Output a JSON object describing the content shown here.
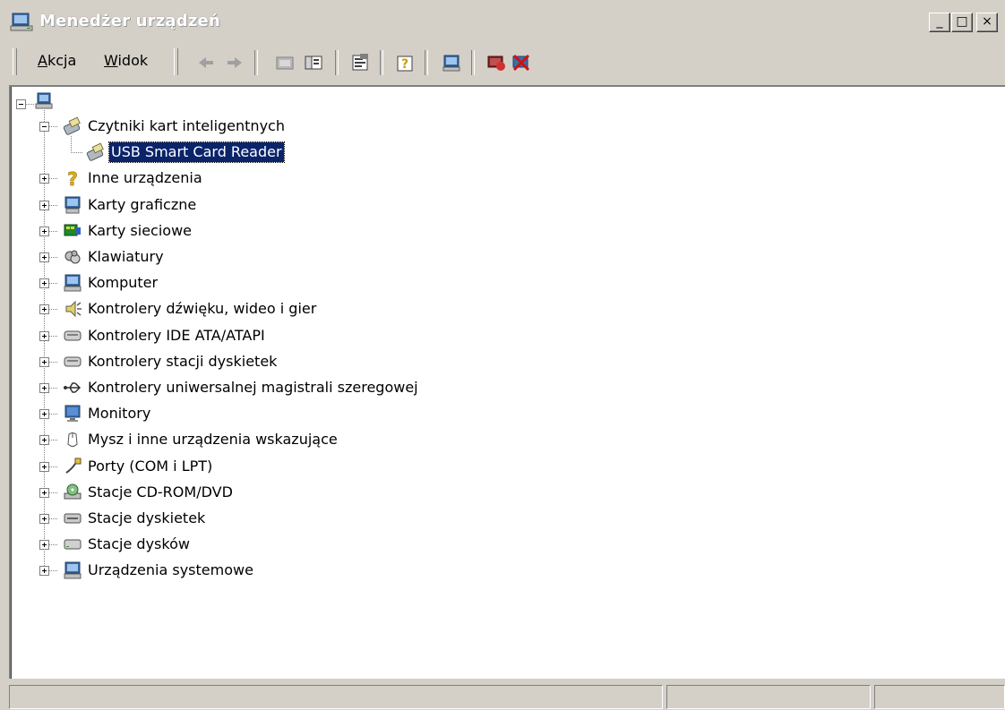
{
  "window": {
    "title": "Menedżer urządzeń",
    "controls": {
      "minimize": "_",
      "maximize": "□",
      "close": "×"
    }
  },
  "menubar": {
    "items": [
      {
        "label_prefix": "",
        "label_u": "A",
        "label_rest": "kcja"
      },
      {
        "label_prefix": "",
        "label_u": "W",
        "label_rest": "idok"
      }
    ]
  },
  "toolbar": {
    "icons": [
      "back-arrow-icon",
      "forward-arrow-icon",
      "up-folder-icon",
      "show-hide-tree-icon",
      "properties-icon",
      "help-icon",
      "scan-hardware-icon",
      "disable-device-icon",
      "uninstall-device-icon"
    ]
  },
  "tree": {
    "root": {
      "icon": "computer-icon",
      "label": ""
    },
    "nodes": [
      {
        "label": "Czytniki kart inteligentnych",
        "icon": "smart-card-reader-icon",
        "expanded": true,
        "children": [
          {
            "label": "USB Smart Card Reader",
            "icon": "smart-card-reader-icon",
            "selected": true
          }
        ]
      },
      {
        "label": "Inne urządzenia",
        "icon": "question-mark-icon"
      },
      {
        "label": "Karty graficzne",
        "icon": "display-adapter-icon"
      },
      {
        "label": "Karty sieciowe",
        "icon": "network-card-icon"
      },
      {
        "label": "Klawiatury",
        "icon": "keyboard-icon"
      },
      {
        "label": "Komputer",
        "icon": "computer-icon"
      },
      {
        "label": "Kontrolery dźwięku, wideo i gier",
        "icon": "speaker-icon"
      },
      {
        "label": "Kontrolery IDE ATA/ATAPI",
        "icon": "ide-controller-icon"
      },
      {
        "label": "Kontrolery stacji dyskietek",
        "icon": "floppy-controller-icon"
      },
      {
        "label": "Kontrolery uniwersalnej magistrali szeregowej",
        "icon": "usb-icon"
      },
      {
        "label": "Monitory",
        "icon": "monitor-icon"
      },
      {
        "label": "Mysz i inne urządzenia wskazujące",
        "icon": "mouse-icon"
      },
      {
        "label": "Porty (COM i LPT)",
        "icon": "port-icon"
      },
      {
        "label": "Stacje CD-ROM/DVD",
        "icon": "cdrom-icon"
      },
      {
        "label": "Stacje dyskietek",
        "icon": "floppy-drive-icon"
      },
      {
        "label": "Stacje dysków",
        "icon": "disk-drive-icon"
      },
      {
        "label": "Urządzenia systemowe",
        "icon": "system-devices-icon"
      }
    ]
  },
  "statusbar": {
    "cells": [
      "",
      "",
      ""
    ]
  }
}
